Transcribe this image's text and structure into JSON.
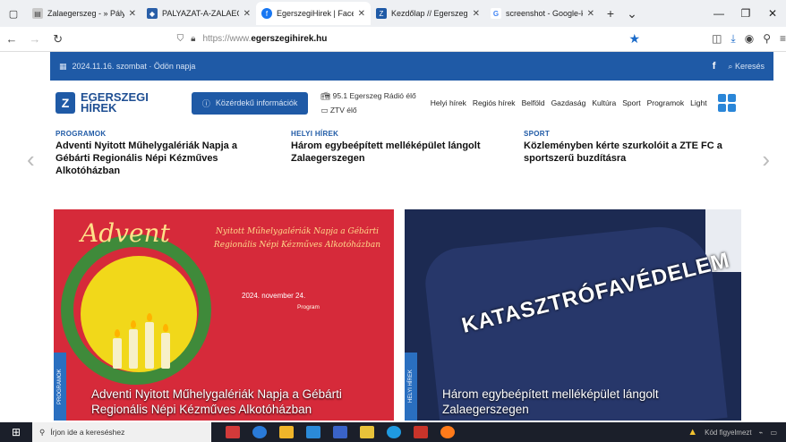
{
  "browser": {
    "tabs": [
      {
        "title": "Zalaegerszeg - » Pályázat",
        "active": false,
        "favicon": "doc-icon"
      },
      {
        "title": "PALYAZAT-A-ZALAEGERS",
        "active": false,
        "favicon": "gov-icon"
      },
      {
        "title": "EgerszegiHirek | Facebook",
        "active": true,
        "favicon": "facebook-icon"
      },
      {
        "title": "Kezdőlap // Egerszegi Hír",
        "active": false,
        "favicon": "ez-icon"
      },
      {
        "title": "screenshot - Google-ker",
        "active": false,
        "favicon": "google-icon"
      }
    ],
    "url_prefix": "https://www.",
    "url_domain": "egerszegihirek.hu"
  },
  "site": {
    "date": "2024.11.16. szombat · Ödön napja",
    "search_label": "Keresés",
    "facebook_glyph": "f",
    "logo_line1": "EGERSZEGI",
    "logo_line2": "HÍREK",
    "info_button": "Közérdekű információk",
    "radio": "95.1 Egerszeg Rádió élő",
    "tv": "ZTV élő",
    "menu": [
      "Helyi hírek",
      "Regiós hírek",
      "Belföld",
      "Gazdaság",
      "Kultúra",
      "Sport",
      "Programok",
      "Light"
    ]
  },
  "ticker": [
    {
      "category": "PROGRAMOK",
      "title": "Adventi Nyitott Műhelygalériák Napja a Gébárti Regionális Népi Kézműves Alkotóházban"
    },
    {
      "category": "HELYI HÍREK",
      "title": "Három egybeépített melléképület lángolt Zalaegerszegen"
    },
    {
      "category": "SPORT",
      "title": "Közleményben kérte szurkolóit a ZTE FC a sportszerű buzdításra"
    }
  ],
  "cards": [
    {
      "label": "PROGRAMOK",
      "title": "Adventi Nyitott Műhelygalériák Napja a Gébárti Regionális Népi Kézműves Alkotóházban",
      "poster_heading": "Advent",
      "poster_sub": "Nyitott Műhelygalériák Napja a Gébárti Regionális Népi Kézműves Alkotóházban",
      "poster_date": "2024. november 24.",
      "poster_program": "Program"
    },
    {
      "label": "HELYI HÍREK",
      "title": "Három egybeépített melléképület lángolt Zalaegerszegen",
      "shirt_text": "KATASZTRÓFAVÉDELEM"
    }
  ],
  "taskbar": {
    "search_placeholder": "Írjon ide a kereséshez",
    "tray_text": "Kód figyelmezt"
  }
}
